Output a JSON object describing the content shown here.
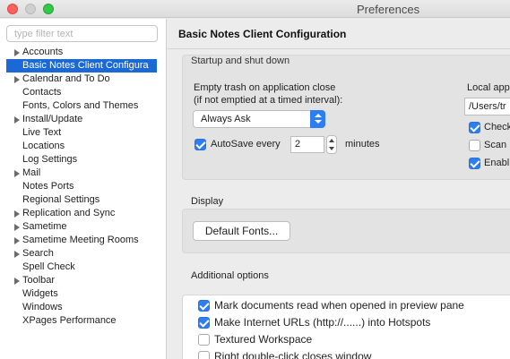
{
  "window": {
    "title": "Preferences"
  },
  "sidebar": {
    "filter_placeholder": "type filter text",
    "items": [
      {
        "label": "Accounts",
        "expandable": true
      },
      {
        "label": "Basic Notes Client Configura",
        "expandable": false,
        "selected": true
      },
      {
        "label": "Calendar and To Do",
        "expandable": true
      },
      {
        "label": "Contacts",
        "expandable": false
      },
      {
        "label": "Fonts, Colors and Themes",
        "expandable": false
      },
      {
        "label": "Install/Update",
        "expandable": true
      },
      {
        "label": "Live Text",
        "expandable": false
      },
      {
        "label": "Locations",
        "expandable": false
      },
      {
        "label": "Log Settings",
        "expandable": false
      },
      {
        "label": "Mail",
        "expandable": true
      },
      {
        "label": "Notes Ports",
        "expandable": false
      },
      {
        "label": "Regional Settings",
        "expandable": false
      },
      {
        "label": "Replication and Sync",
        "expandable": true
      },
      {
        "label": "Sametime",
        "expandable": true
      },
      {
        "label": "Sametime Meeting Rooms",
        "expandable": true
      },
      {
        "label": "Search",
        "expandable": true
      },
      {
        "label": "Spell Check",
        "expandable": false
      },
      {
        "label": "Toolbar",
        "expandable": true
      },
      {
        "label": "Widgets",
        "expandable": false
      },
      {
        "label": "Windows",
        "expandable": false
      },
      {
        "label": "XPages Performance",
        "expandable": false
      }
    ]
  },
  "main": {
    "title": "Basic Notes Client Configuration",
    "startup": {
      "group_label": "Startup and shut down",
      "empty_trash_label_line1": "Empty trash on application close",
      "empty_trash_label_line2": "(if not emptied at a timed interval):",
      "empty_trash_value": "Always Ask",
      "autosave_label": "AutoSave every",
      "autosave_checked": true,
      "autosave_value": "2",
      "autosave_unit": "minutes",
      "local_label": "Local app",
      "local_path": "/Users/tr",
      "right_checks": [
        {
          "label": "Check",
          "checked": true
        },
        {
          "label": "Scan",
          "checked": false
        },
        {
          "label": "Enabl",
          "checked": true
        }
      ]
    },
    "display": {
      "group_label": "Display",
      "default_fonts_button": "Default Fonts..."
    },
    "additional": {
      "group_label": "Additional options",
      "options": [
        {
          "label": "Mark documents read when opened in preview pane",
          "checked": true
        },
        {
          "label": "Make Internet URLs (http://......) into Hotspots",
          "checked": true
        },
        {
          "label": "Textured Workspace",
          "checked": false
        },
        {
          "label": "Right double-click closes window",
          "checked": false
        }
      ]
    }
  },
  "colors": {
    "selection": "#1a69d4",
    "accent": "#2d7ef2"
  }
}
